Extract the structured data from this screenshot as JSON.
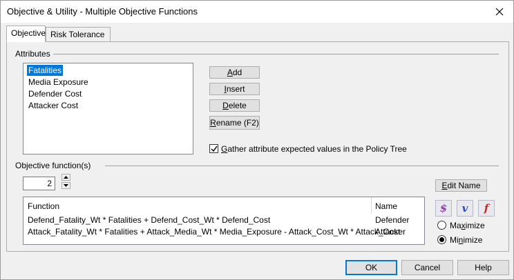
{
  "window": {
    "title": "Objective & Utility - Multiple Objective Functions"
  },
  "tabs": [
    {
      "label": "Objective",
      "active": true
    },
    {
      "label": "Risk Tolerance",
      "active": false
    }
  ],
  "attributes": {
    "group_label": "Attributes",
    "items": [
      "Fatalities",
      "Media Exposure",
      "Defender Cost",
      "Attacker Cost"
    ],
    "selected": "Fatalities",
    "buttons": {
      "add": {
        "mnemonic": "A",
        "rest": "dd"
      },
      "insert": {
        "mnemonic": "I",
        "rest": "nsert"
      },
      "delete": {
        "mnemonic": "D",
        "rest": "elete"
      },
      "rename": {
        "mnemonic": "R",
        "rest": "ename (F2)"
      }
    },
    "gather_checkbox": {
      "checked": true,
      "mnemonic": "G",
      "rest": "ather attribute expected values in the Policy Tree"
    }
  },
  "objective_functions": {
    "group_label": "Objective function(s)",
    "count": "2",
    "edit_name": {
      "mnemonic": "E",
      "rest": "dit Name"
    },
    "columns": {
      "function": "Function",
      "name": "Name"
    },
    "rows": [
      {
        "function": "Defend_Fatality_Wt * Fatalities + Defend_Cost_Wt * Defend_Cost",
        "name": "Defender"
      },
      {
        "function": "Attack_Fatality_Wt * Fatalities + Attack_Media_Wt * Media_Exposure - Attack_Cost_Wt * Attack_Cost",
        "name": "Attacker"
      }
    ],
    "icons": [
      {
        "glyph": "$",
        "name": "dollar-icon",
        "color": "#8a3fa8"
      },
      {
        "glyph": "v",
        "name": "value-v-icon",
        "color": "#2b4db8"
      },
      {
        "glyph": "f",
        "name": "function-f-icon",
        "color": "#c0282d"
      }
    ],
    "maximize": {
      "pre": "Ma",
      "mnemonic": "x",
      "rest": "imize",
      "checked": false
    },
    "minimize": {
      "pre": "Mi",
      "mnemonic": "n",
      "rest": "imize",
      "checked": true
    }
  },
  "footer": {
    "ok": "OK",
    "cancel": "Cancel",
    "help": "Help"
  },
  "colors": {
    "selection": "#0078d7",
    "default_button_border": "#0078d7"
  }
}
